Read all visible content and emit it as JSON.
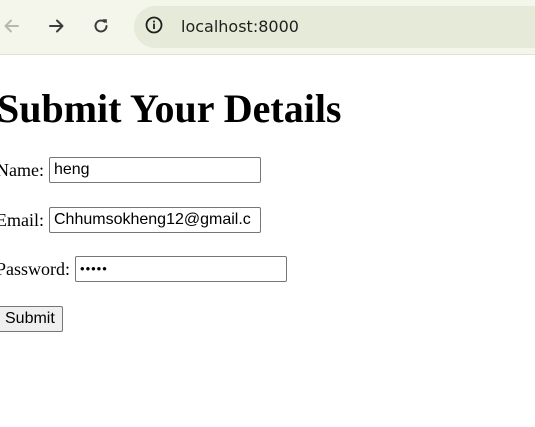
{
  "browser": {
    "url": "localhost:8000",
    "icons": {
      "back": "arrow-left-icon",
      "forward": "arrow-right-icon",
      "reload": "reload-icon",
      "site_info": "info-circle-icon"
    },
    "colors": {
      "toolbar_bg": "#f4f6ec",
      "omnibox_bg": "#e6ead8"
    }
  },
  "page": {
    "title": "Submit Your Details",
    "form": {
      "name": {
        "label": "Name:",
        "value": "heng"
      },
      "email": {
        "label": "Email:",
        "value": "Chhumsokheng12@gmail.c"
      },
      "password": {
        "label": "Password:",
        "masked_value": "•••••"
      },
      "submit_label": "Submit"
    }
  }
}
